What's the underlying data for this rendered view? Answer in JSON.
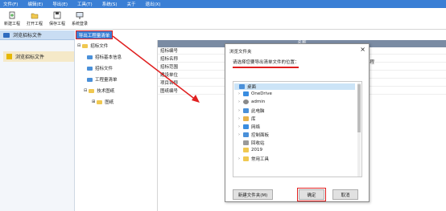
{
  "menubar": [
    "文件(F)",
    "编辑(E)",
    "导出(E)",
    "工具(T)",
    "系统(S)",
    "关于",
    "退出(X)"
  ],
  "toolbar": [
    {
      "label": "新建工程",
      "icon": "new-project-icon"
    },
    {
      "label": "打开工程",
      "icon": "open-project-icon"
    },
    {
      "label": "保存工程",
      "icon": "save-project-icon"
    },
    {
      "label": "系统登录",
      "icon": "system-login-icon"
    }
  ],
  "sidebar": {
    "title": "浏览招标文件",
    "item": "浏览招标文件"
  },
  "export_tab": "导出工程量清单",
  "tree": {
    "root": "招标文件",
    "items": [
      "招标基本信息",
      "招标文件",
      "工程量清单",
      "技术图纸",
      "图纸"
    ]
  },
  "grid": {
    "header": "名称",
    "rows": [
      "招标编号",
      "招标名称",
      "招标范围",
      "建设单位",
      "项目名称",
      "图纸编号"
    ],
    "right_cell": "工程"
  },
  "dialog": {
    "title": "浏览文件夹",
    "message": "请选择您要导出清单文件的位置：",
    "close": "×",
    "nodes": [
      {
        "label": "桌面",
        "color": "#4a90d9",
        "chev": "",
        "selected": true
      },
      {
        "label": "OneDrive",
        "color": "#3a8de0",
        "chev": "›"
      },
      {
        "label": "admin",
        "color": "#8a8a8a",
        "chev": "›"
      },
      {
        "label": "此电脑",
        "color": "#4a90d9",
        "chev": "›"
      },
      {
        "label": "库",
        "color": "#e8b24a",
        "chev": "›"
      },
      {
        "label": "网络",
        "color": "#3a8de0",
        "chev": "›"
      },
      {
        "label": "控制面板",
        "color": "#4a90d9",
        "chev": "›"
      },
      {
        "label": "回收站",
        "color": "#9a9a9a",
        "chev": ""
      },
      {
        "label": "2019",
        "color": "#f0c850",
        "chev": ""
      },
      {
        "label": "常用工具",
        "color": "#f0c850",
        "chev": "›"
      }
    ],
    "new_folder": "新建文件夹(M)",
    "ok": "确定",
    "cancel": "取消"
  },
  "colors": {
    "accent": "#3a7fd5",
    "highlight": "#e02020"
  }
}
